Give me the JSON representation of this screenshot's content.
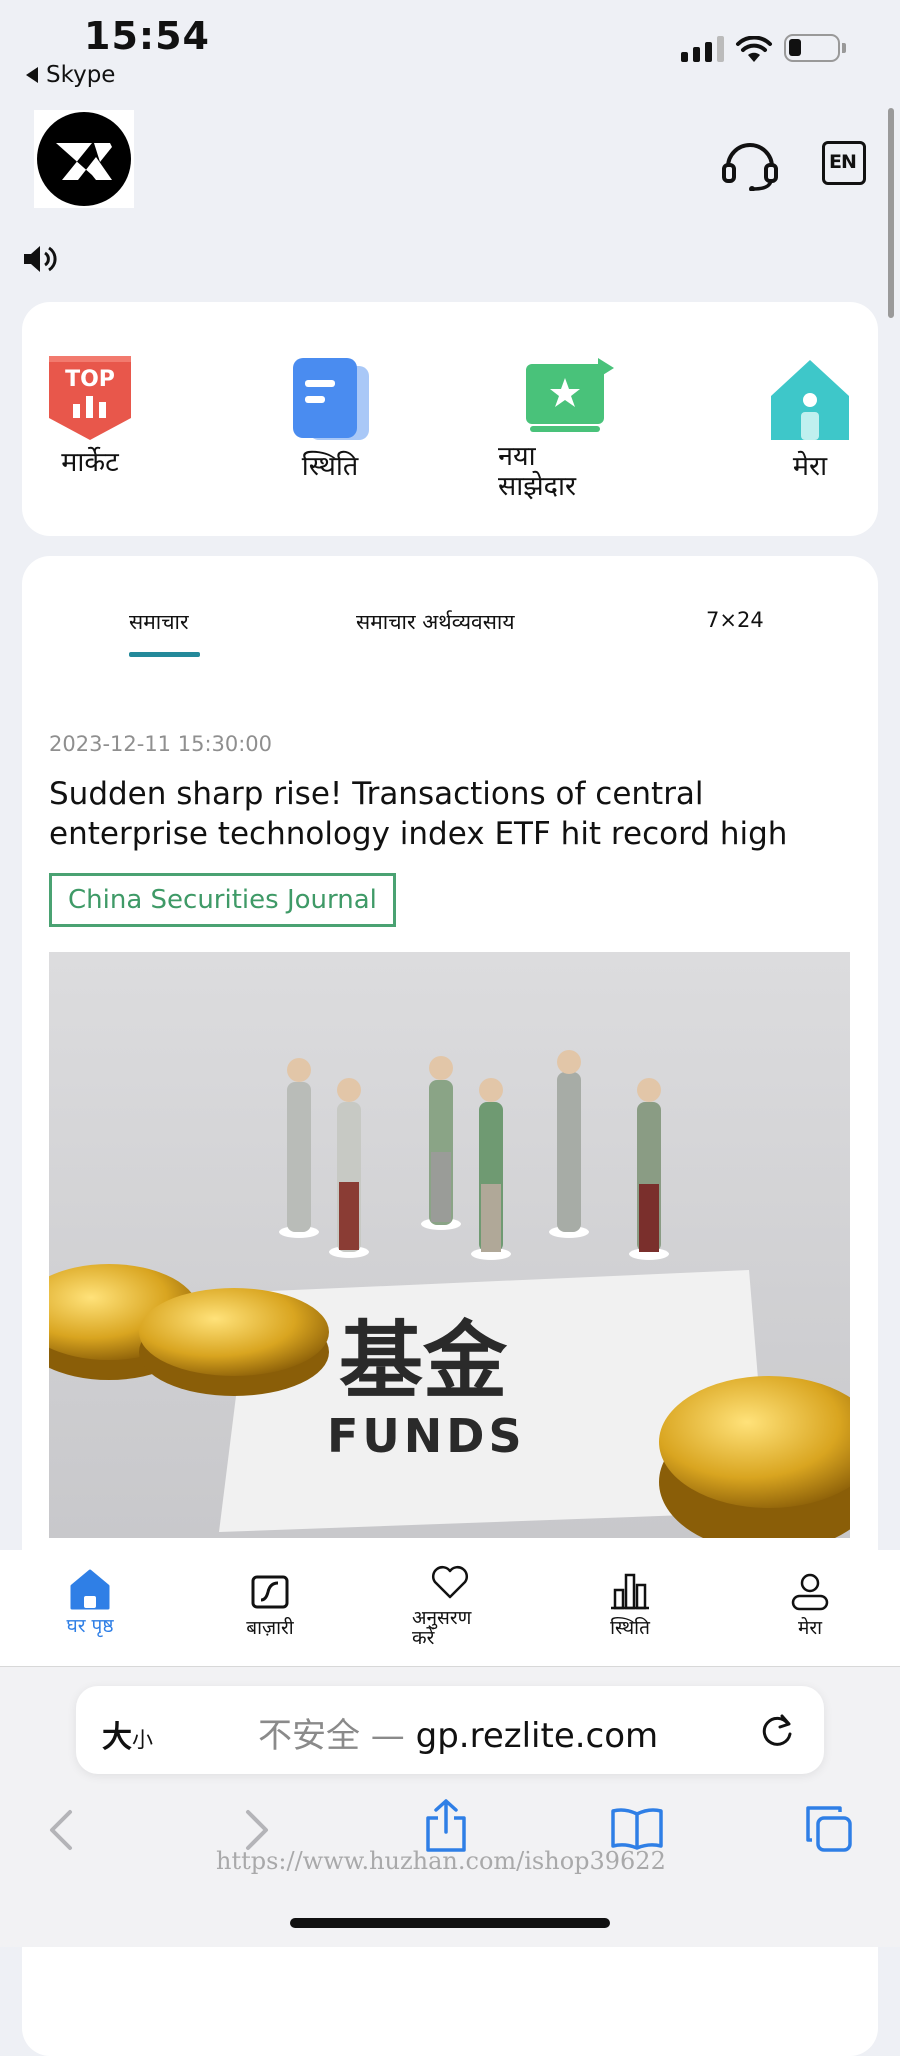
{
  "status_bar": {
    "time": "15:54",
    "back_app": "Skype"
  },
  "header": {
    "support_icon": "headset-icon",
    "language_button": "EN"
  },
  "quick_links": [
    {
      "label": "मार्केट",
      "icon": "top-chart-icon",
      "color": "#e8574b"
    },
    {
      "label": "स्थिति",
      "icon": "document-icon",
      "color": "#4a8cf0"
    },
    {
      "label": "नया साझेदार",
      "icon": "star-screen-icon",
      "color": "#49c27a"
    },
    {
      "label": "मेरा",
      "icon": "home-icon",
      "color": "#3ec7c9"
    }
  ],
  "news_tabs": [
    {
      "label": "समाचार",
      "active": true
    },
    {
      "label": "समाचार अर्थव्यवसाय",
      "active": false
    },
    {
      "label": "7×24",
      "active": false
    }
  ],
  "news": {
    "date": "2023-12-11 15:30:00",
    "title": "Sudden sharp rise! Transactions of central enterprise technology index ETF hit record high",
    "source": "China Securities Journal",
    "image_caption_cn": "基金",
    "image_caption_en": "FUNDS"
  },
  "bottom_nav": [
    {
      "label": "घर पृष्ठ",
      "icon": "home-icon",
      "active": true
    },
    {
      "label": "बाज़ारी",
      "icon": "chart-line-icon",
      "active": false
    },
    {
      "label": "अनुसरण करें",
      "icon": "heart-icon",
      "active": false
    },
    {
      "label": "स्थिति",
      "icon": "bar-chart-icon",
      "active": false
    },
    {
      "label": "मेरा",
      "icon": "user-icon",
      "active": false
    }
  ],
  "browser": {
    "text_size_big": "大",
    "text_size_small": "小",
    "insecure_label": "不安全 —",
    "domain": "gp.rezlite.com"
  },
  "watermark": "https://www.huzhan.com/ishop39622",
  "colors": {
    "accent": "#23899a",
    "nav_active": "#2f7fe6",
    "source_green": "#3f9a67"
  }
}
